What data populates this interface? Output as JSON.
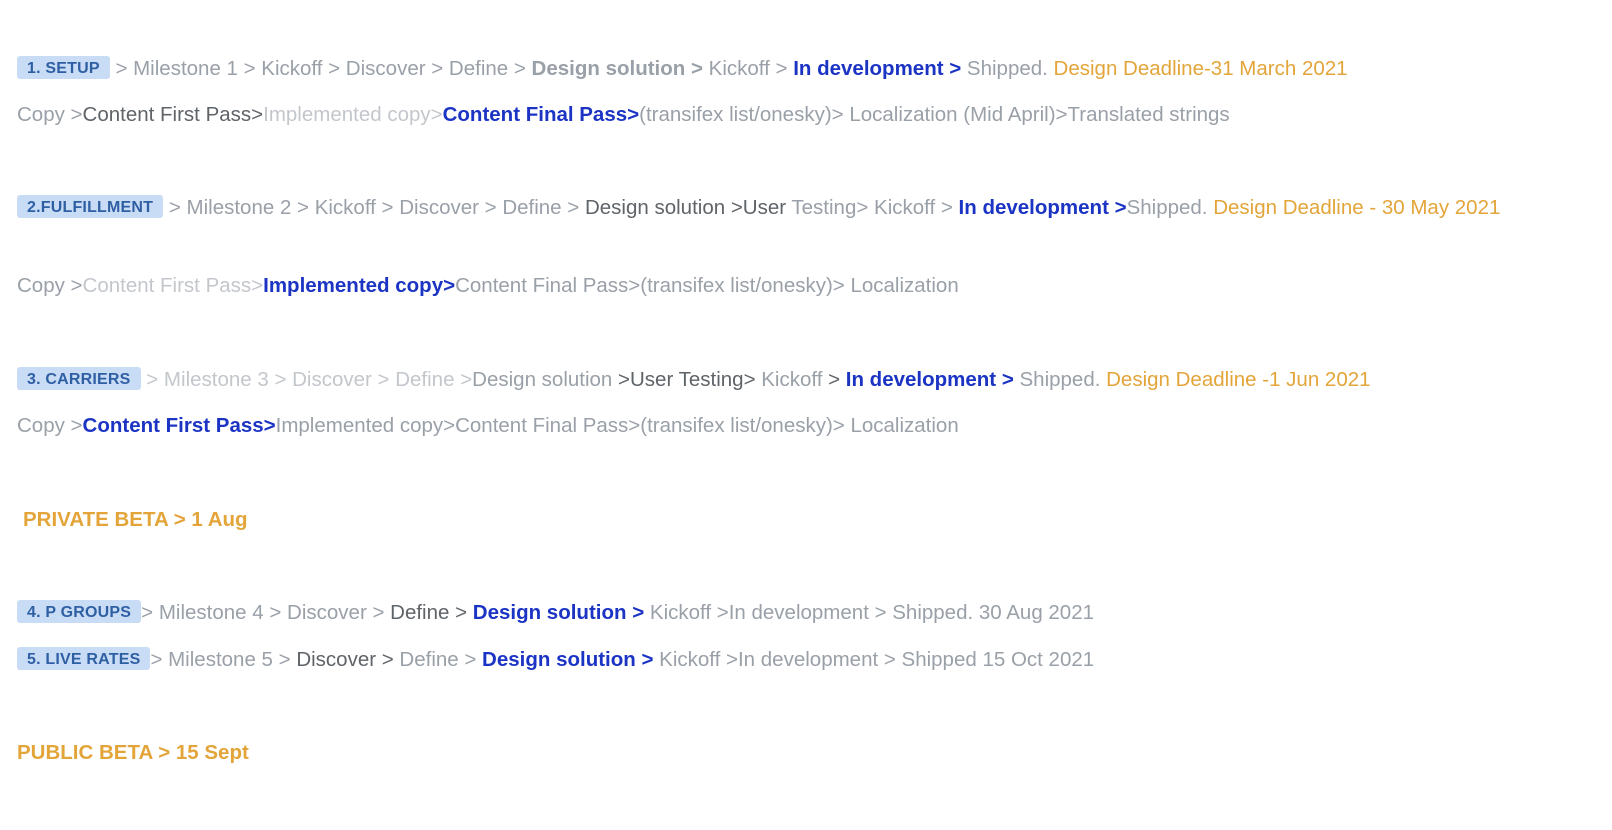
{
  "setup": {
    "tag": "1. SETUP",
    "steps": [
      " > Milestone 1 > Kickoff > Discover > Define  > ",
      "Design solution > ",
      "Kickoff > ",
      "In development > ",
      "Shipped. "
    ],
    "deadline": "Design Deadline-31 March 2021",
    "copy": [
      "Copy >",
      "Content First Pass>",
      "Implemented copy>",
      "Content Final Pass>",
      "(transifex list/onesky)> Localization (Mid April)>Translated strings"
    ]
  },
  "fulfillment": {
    "tag": "2.FULFILLMENT",
    "steps": [
      " > Milestone 2 > Kickoff > Discover > Define  > ",
      "Design solution >User ",
      "Testing> Kickoff > ",
      "In development >",
      "Shipped.  "
    ],
    "deadline": "Design Deadline - 30 May 2021",
    "copy": [
      "Copy >",
      "Content First Pass>",
      "Implemented copy>",
      "Content Final Pass>(transifex list/onesky)> Localization"
    ]
  },
  "carriers": {
    "tag": "3. CARRIERS",
    "steps": [
      " > Milestone 3 > Discover > Define  >",
      "Design solution ",
      ">User Testing> ",
      "Kickoff ",
      "> ",
      "In development > ",
      "Shipped.   "
    ],
    "deadline": "Design Deadline -1 Jun 2021",
    "copy": [
      "Copy >",
      "Content First Pass>",
      "Implemented copy>Content Final Pass>(transifex list/onesky)> Localization"
    ]
  },
  "private_beta": "PRIVATE BETA > 1 Aug",
  "p_groups": {
    "tag": "4. P GROUPS",
    "steps": [
      "> Milestone 4 >  Discover > ",
      "Define  > ",
      "Design solution > ",
      "Kickoff >In development > Shipped.       30 Aug 2021"
    ]
  },
  "live_rates": {
    "tag": "5. LIVE RATES",
    "steps": [
      "> Milestone 5 >  ",
      "Discover > ",
      "Define  > ",
      "Design solution > ",
      "Kickoff >In development > Shipped        15 Oct 2021"
    ]
  },
  "public_beta": "PUBLIC BETA > 15 Sept"
}
